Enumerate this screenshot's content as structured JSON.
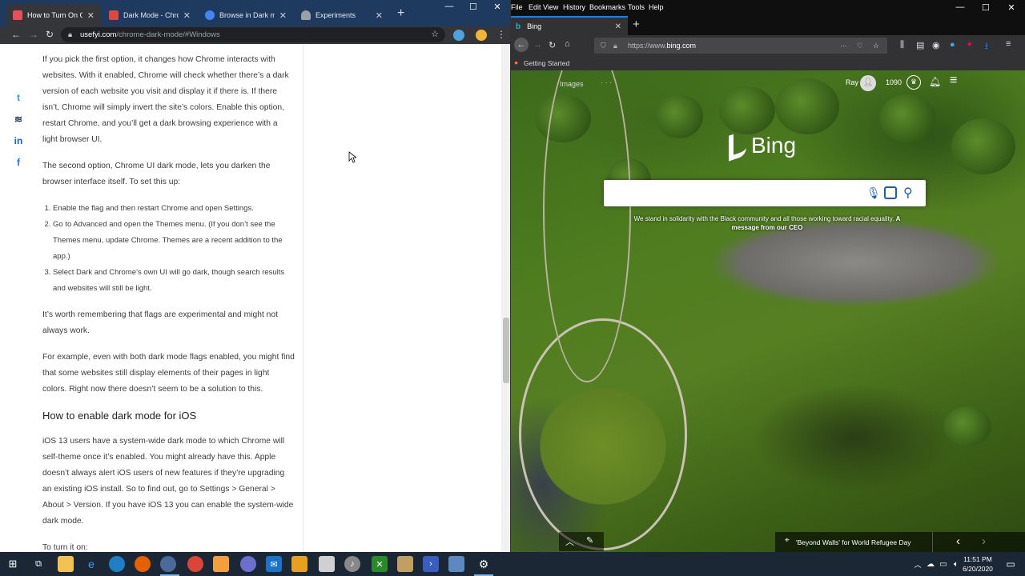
{
  "chrome": {
    "tabs": [
      {
        "title": "How to Turn On Chro",
        "favicon_color": "#e94e5c",
        "active": true
      },
      {
        "title": "Dark Mode - Chrome",
        "favicon_color": "#e0463c",
        "active": false
      },
      {
        "title": "Browse in Dark mode",
        "favicon_color": "#4285f4",
        "active": false
      },
      {
        "title": "Experiments",
        "favicon_color": "#9aa0a6",
        "active": false
      }
    ],
    "new_tab": "+",
    "url": {
      "host": "usefyi.com",
      "path": "/chrome-dark-mode/#Windows"
    },
    "share_icons": [
      "t",
      "≋",
      "in",
      "f"
    ],
    "article": {
      "p1": "If you pick the first option, it changes how Chrome interacts with websites. With it enabled, Chrome will check whether there’s a dark version of each website you visit and display it if there is. If there isn’t, Chrome will simply invert the site’s colors. Enable this option, restart Chrome, and you’ll get a dark browsing experience with a light browser UI.",
      "p2": "The second option, Chrome UI dark mode, lets you darken the browser interface itself. To set this up:",
      "steps": [
        "Enable the flag and then restart Chrome and open Settings.",
        "Go to Advanced and open the Themes menu. (If you don’t see the Themes menu, update Chrome. Themes are a recent addition to the app.)",
        "Select Dark and Chrome’s own UI will go dark, though search results and websites will still be light."
      ],
      "p3": "It’s worth remembering that flags are experimental and might not always work.",
      "p4": "For example, even with both dark mode flags enabled, you might find that some websites still display elements of their pages in light colors. Right now there doesn’t seem to be a solution to this.",
      "h2": "How to enable dark mode for iOS",
      "p5": "iOS 13 users have a system-wide dark mode to which Chrome will self-theme once it’s enabled. You might already have this. Apple doesn’t always alert iOS users of new features if they’re upgrading an existing iOS install. So to find out, go to Settings > General > About > Version. If you have iOS 13 you can enable the system-wide dark mode.",
      "p6": "To turn it on:"
    }
  },
  "firefox": {
    "menu": [
      "File",
      "Edit",
      "View",
      "History",
      "Bookmarks",
      "Tools",
      "Help"
    ],
    "tab_title": "Bing",
    "url": {
      "prefix": "https://www.",
      "host": "bing.com"
    },
    "bookmark": "Getting Started",
    "bing": {
      "images_link": "Images",
      "more": "· · ·",
      "user_name": "Ray",
      "rewards_points": "1090",
      "logo_text": "Bing",
      "search_value": "",
      "message": "We stand in solidarity with the Black community and all those working toward racial equality.",
      "message_link": "A message from our CEO",
      "image_caption": "'Beyond Walls' for World Refugee Day",
      "prev": "‹",
      "next": "›"
    }
  },
  "taskbar": {
    "time": "11:51 PM",
    "date": "6/20/2020"
  }
}
